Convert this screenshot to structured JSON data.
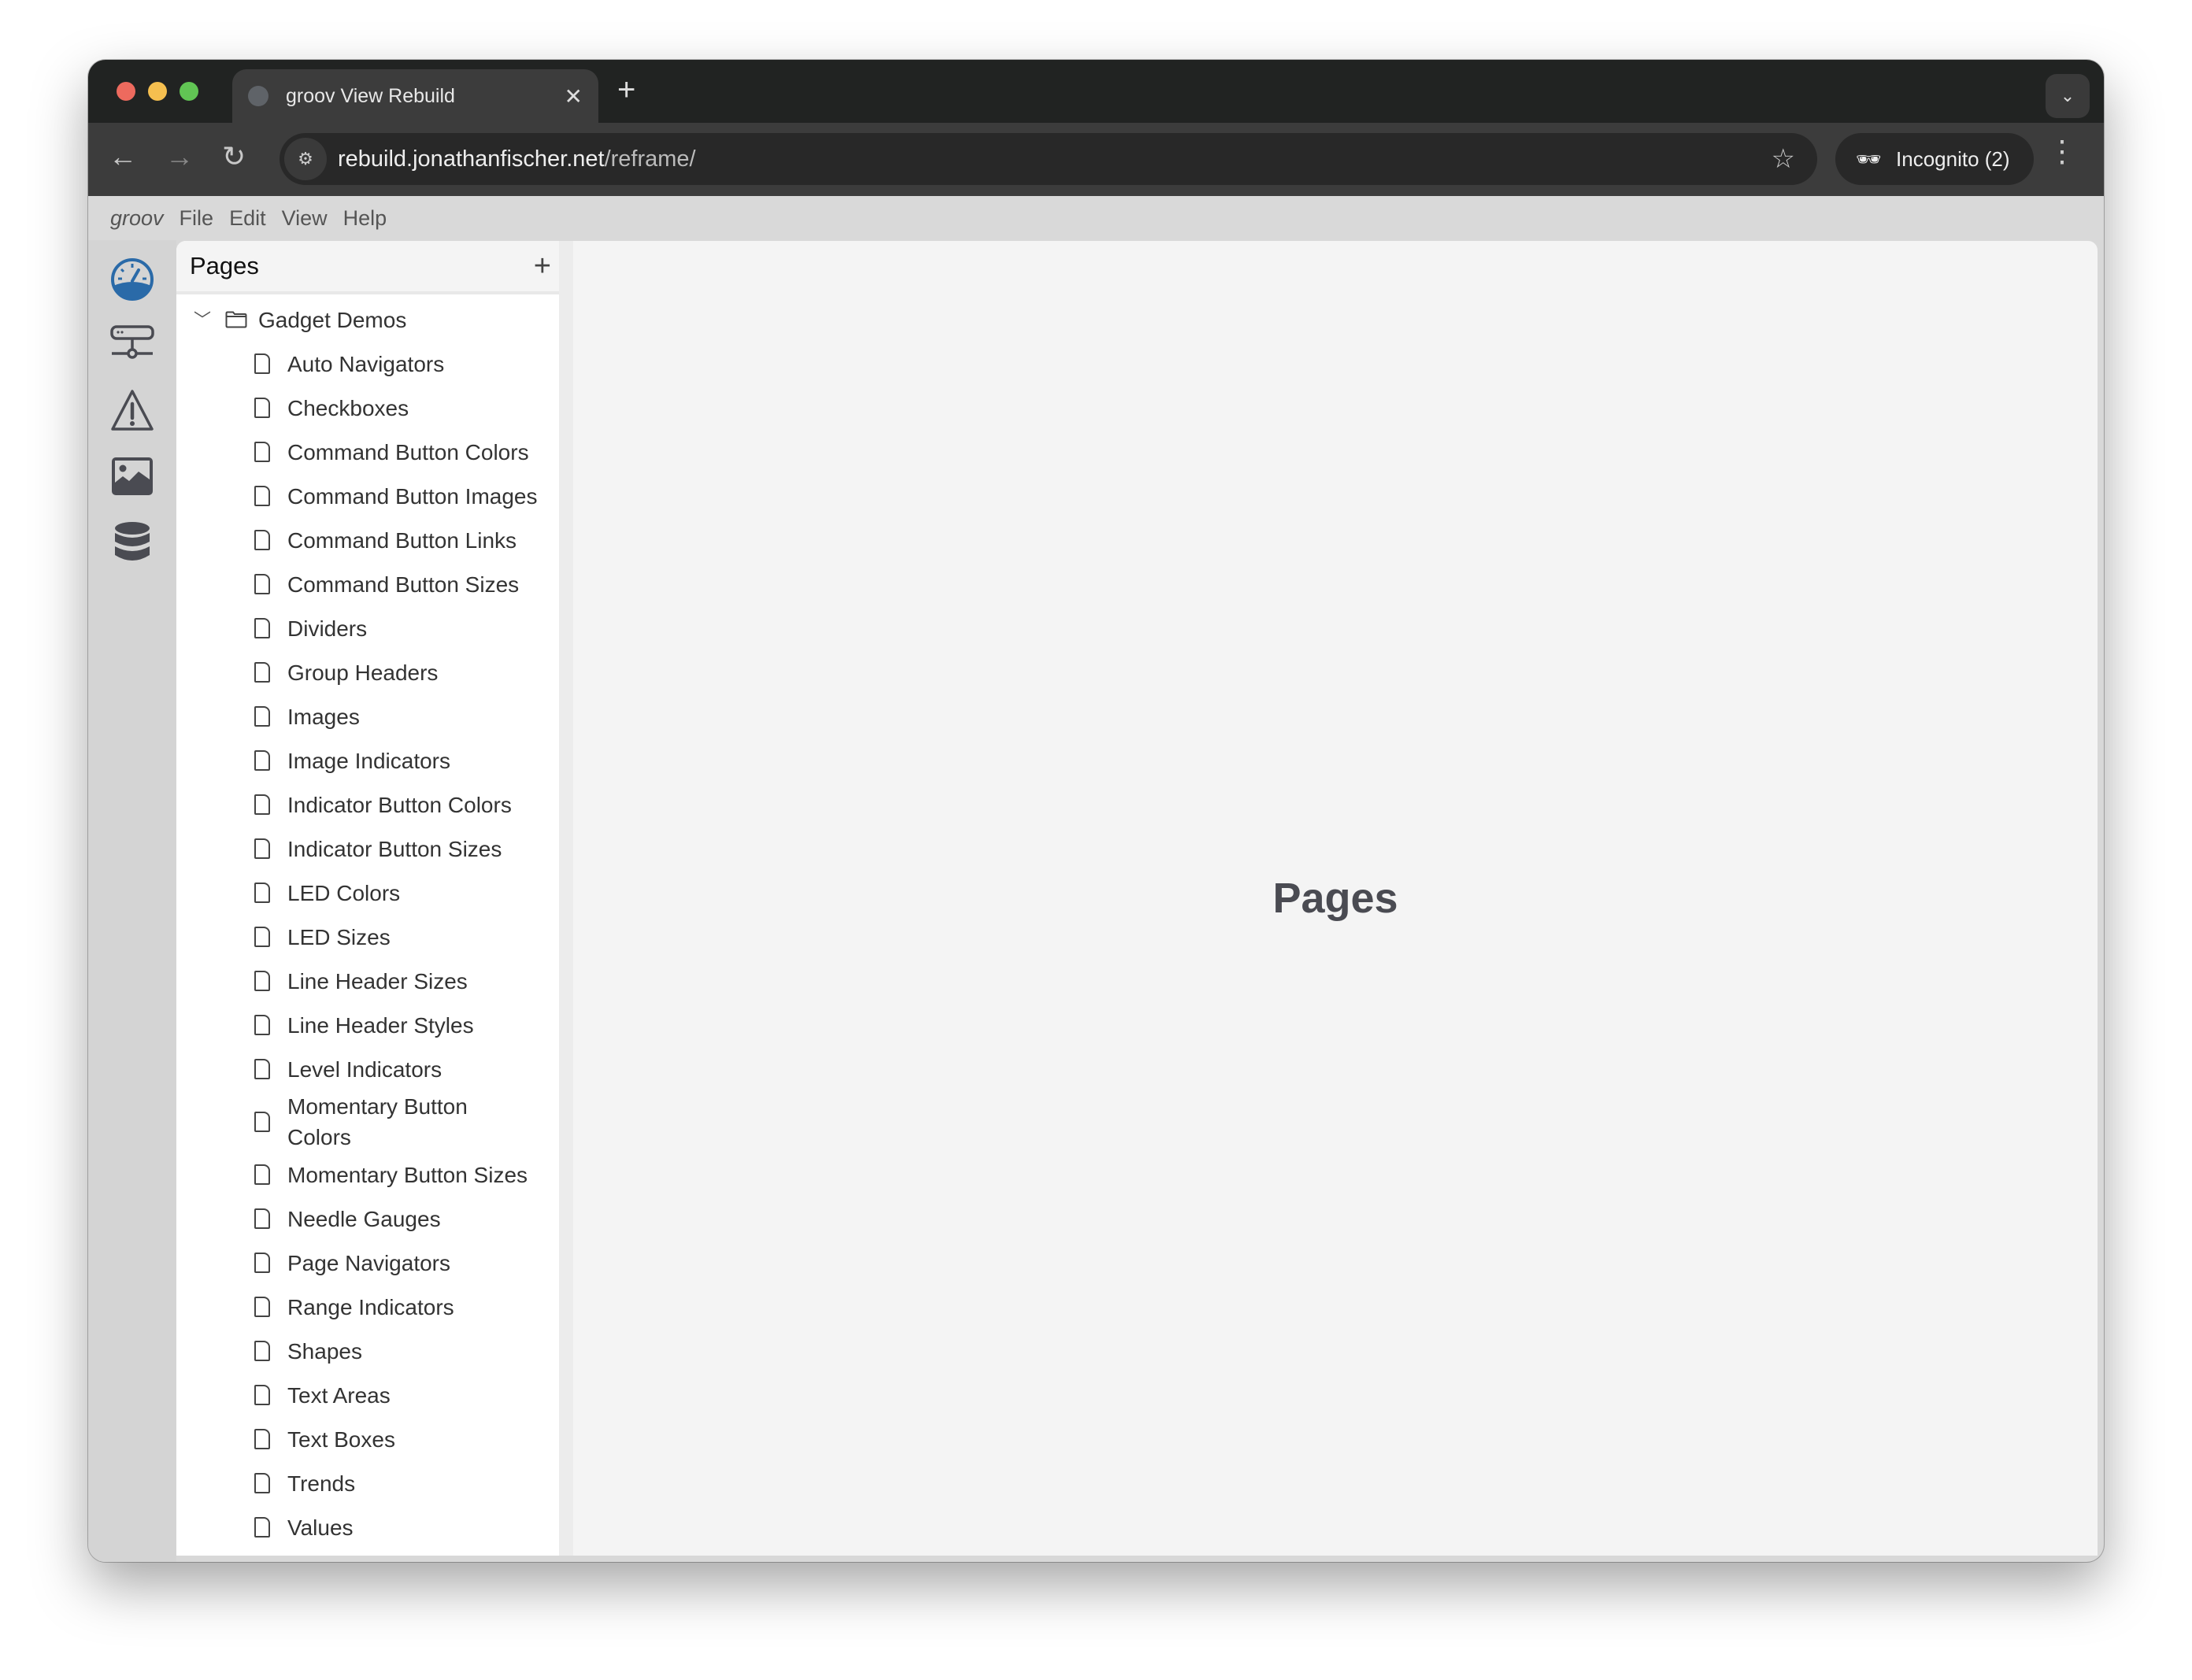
{
  "browser": {
    "tab_title": "groov View Rebuild",
    "url_host": "rebuild.jonathanfischer.net",
    "url_path": "/reframe/",
    "incognito_label": "Incognito (2)",
    "traffic_colors": [
      "#ed6a5e",
      "#f5bf4f",
      "#61c554"
    ]
  },
  "menubar": {
    "brand": "groov",
    "items": [
      "File",
      "Edit",
      "View",
      "Help"
    ]
  },
  "rail": {
    "icons": [
      "dashboard-gauge-icon",
      "network-device-icon",
      "warning-icon",
      "image-icon",
      "database-icon",
      "settings-gear-icon"
    ],
    "accent": "#2a6aa8"
  },
  "panel": {
    "title": "Pages",
    "folder": "Gadget Demos",
    "items": [
      "Auto Navigators",
      "Checkboxes",
      "Command Button Colors",
      "Command Button Images",
      "Command Button Links",
      "Command Button Sizes",
      "Dividers",
      "Group Headers",
      "Images",
      "Image Indicators",
      "Indicator Button Colors",
      "Indicator Button Sizes",
      "LED Colors",
      "LED Sizes",
      "Line Header Sizes",
      "Line Header Styles",
      "Level Indicators",
      "Momentary Button Colors",
      "Momentary Button Sizes",
      "Needle Gauges",
      "Page Navigators",
      "Range Indicators",
      "Shapes",
      "Text Areas",
      "Text Boxes",
      "Trends",
      "Values"
    ]
  },
  "main": {
    "heading": "Pages"
  }
}
